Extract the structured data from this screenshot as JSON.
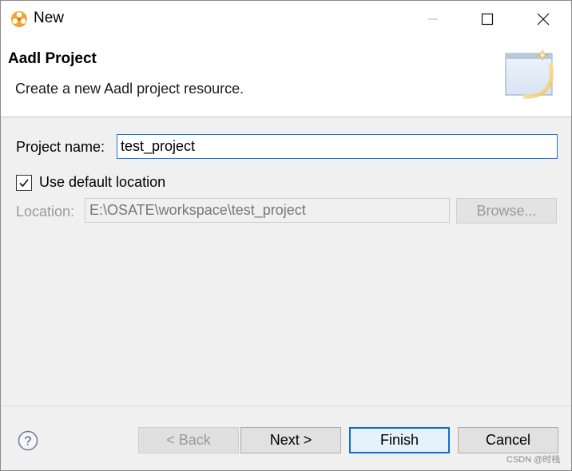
{
  "window": {
    "title": "New",
    "icon": "osate-app-icon",
    "controls": {
      "minimize": "minimize-icon",
      "maximize": "maximize-icon",
      "close": "close-icon"
    }
  },
  "banner": {
    "title": "Aadl Project",
    "description": "Create a new Aadl project resource.",
    "image": "new-project-wizard-icon"
  },
  "form": {
    "project_name_label": "Project name:",
    "project_name_value": "test_project",
    "use_default_location_label": "Use default location",
    "use_default_location_checked": true,
    "location_label": "Location:",
    "location_value": "E:\\OSATE\\workspace\\test_project",
    "browse_label": "Browse..."
  },
  "footer": {
    "help_icon": "help-icon",
    "back_label": "< Back",
    "next_label": "Next >",
    "finish_label": "Finish",
    "cancel_label": "Cancel"
  },
  "watermark": "CSDN @时栈",
  "colors": {
    "accent": "#0f6fd1",
    "disabled_text": "#9a9a9a",
    "dialog_bg": "#f0f0f0"
  }
}
